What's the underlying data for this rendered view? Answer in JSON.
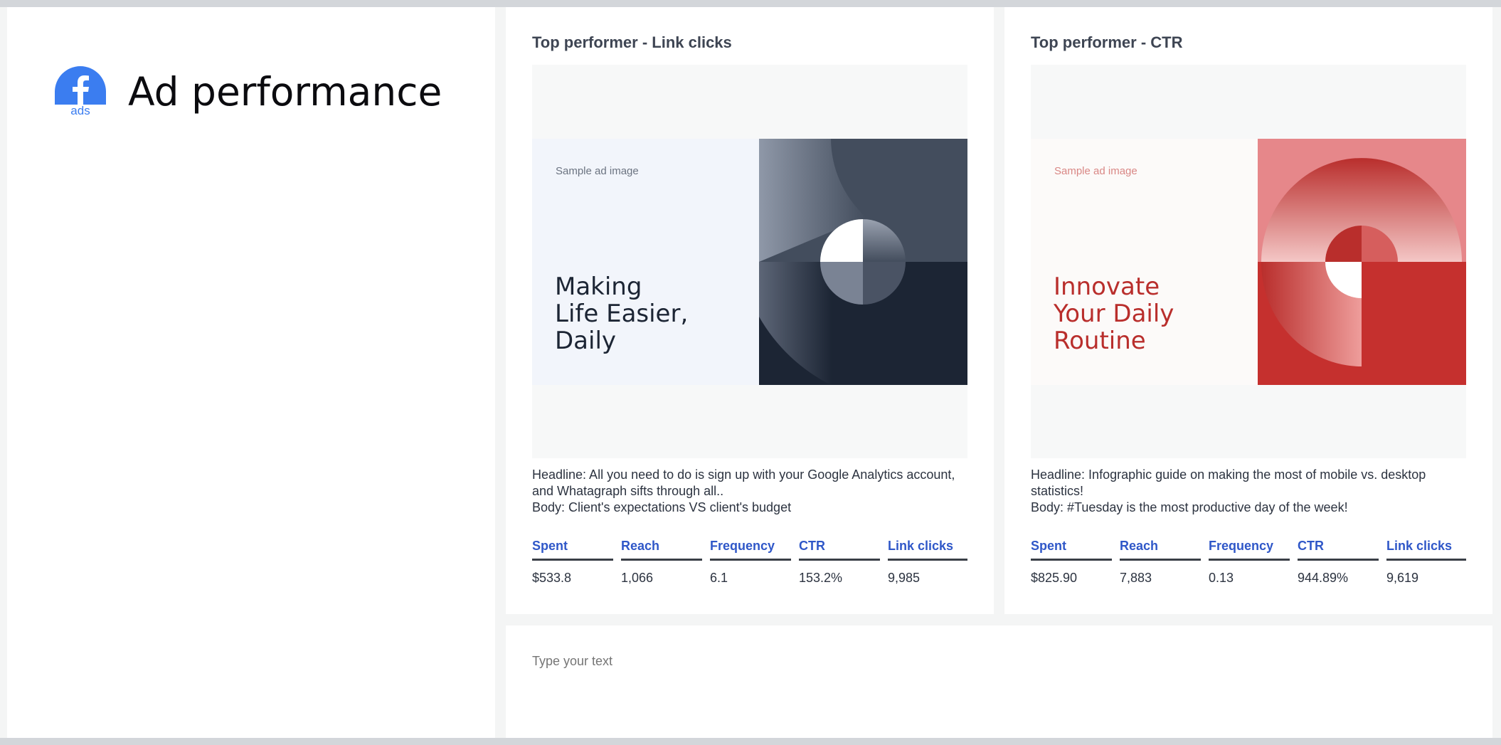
{
  "header": {
    "logo_icon": "facebook-ads-icon",
    "logo_subtext": "ads",
    "title": "Ad performance"
  },
  "cards": [
    {
      "title": "Top performer - Link clicks",
      "ad_image": {
        "caption": "Sample ad image",
        "headline_lines": [
          "Making",
          "Life Easier,",
          "Daily"
        ],
        "theme_color": "#1c2534"
      },
      "headline": "Headline: All you need to do is sign up with your Google Analytics account, and Whatagraph sifts through all..",
      "body": "Body: Client's expectations VS client's budget",
      "metrics": [
        {
          "label": "Spent",
          "value": "$533.8"
        },
        {
          "label": "Reach",
          "value": "1,066"
        },
        {
          "label": "Frequency",
          "value": "6.1"
        },
        {
          "label": "CTR",
          "value": "153.2%"
        },
        {
          "label": "Link clicks",
          "value": "9,985"
        }
      ]
    },
    {
      "title": "Top performer - CTR",
      "ad_image": {
        "caption": "Sample ad image",
        "headline_lines": [
          "Innovate",
          "Your Daily",
          "Routine"
        ],
        "theme_color": "#b92e2c"
      },
      "headline": "Headline: Infographic guide on making the most of mobile vs. desktop statistics!",
      "body": "Body: #Tuesday is the most productive day of the week!",
      "metrics": [
        {
          "label": "Spent",
          "value": "$825.90"
        },
        {
          "label": "Reach",
          "value": "7,883"
        },
        {
          "label": "Frequency",
          "value": "0.13"
        },
        {
          "label": "CTR",
          "value": "944.89%"
        },
        {
          "label": "Link clicks",
          "value": "9,619"
        }
      ]
    }
  ],
  "notes": {
    "placeholder": "Type your text",
    "value": ""
  },
  "colors": {
    "accent": "#2f57c8",
    "facebook_blue": "#3b7df0"
  }
}
